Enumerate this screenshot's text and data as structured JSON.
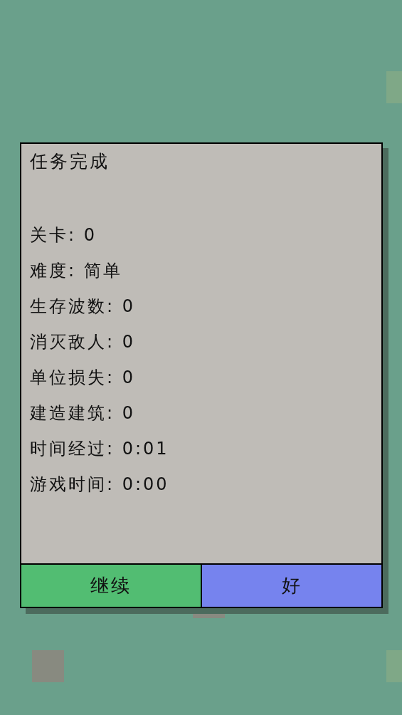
{
  "dialog": {
    "title": "任务完成",
    "stats": [
      "关卡: 0",
      "难度: 简单",
      "生存波数: 0",
      "消灭敌人: 0",
      "单位损失: 0",
      "建造建筑: 0",
      "时间经过: 0:01",
      "游戏时间: 0:00"
    ],
    "buttons": [
      {
        "label": "继续",
        "color": "#52bd72"
      },
      {
        "label": "好",
        "color": "#7683ee"
      }
    ]
  }
}
